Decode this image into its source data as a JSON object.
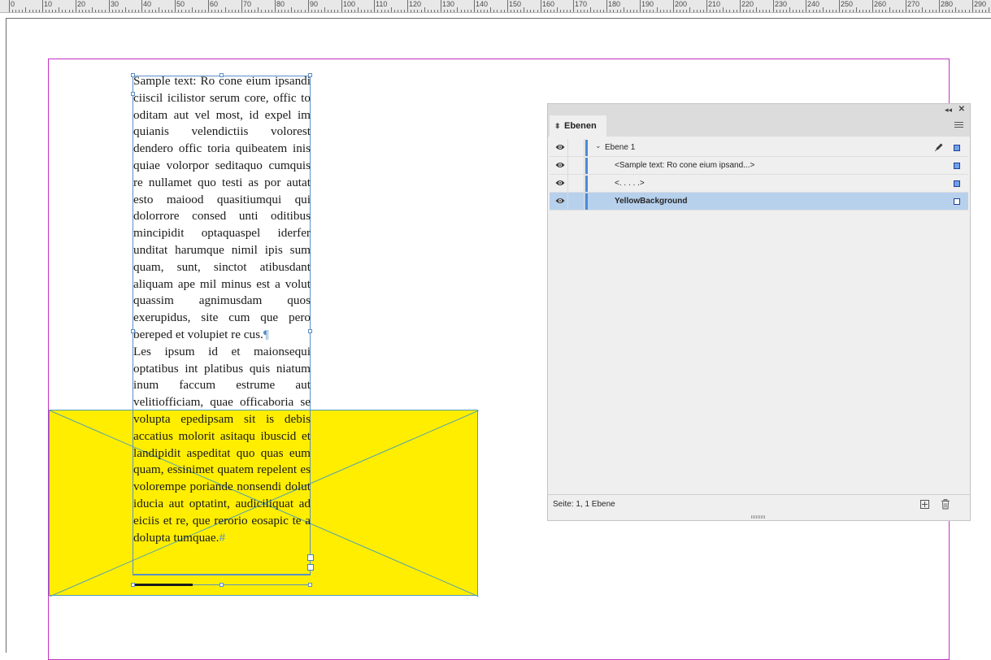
{
  "ruler": {
    "labels": [
      "0",
      "10",
      "20",
      "30",
      "40",
      "50",
      "60",
      "70",
      "80",
      "90",
      "100",
      "110",
      "120",
      "130",
      "140",
      "150",
      "160",
      "170",
      "180",
      "190",
      "200",
      "210",
      "220",
      "230",
      "240",
      "250",
      "260",
      "270",
      "280",
      "290"
    ]
  },
  "document": {
    "text_frame": {
      "paragraph1": "Sample text: Ro cone eium ipsandi ciiscil icilistor serum core, offic to oditam aut vel most, id expel im quianis velendictiis volorest dendero offic toria quibeatem inis quiae volorpor seditaquo cumquis re nullamet quo testi as por autat esto maiood quasitiumqui qui dolorrore consed unti oditibus mincipidit optaquaspel iderfer unditat harumque nimil ipis sum quam, sunt, sinctot atibusdant aliquam ape mil minus est a volut quassim agnimusdam quos exerupidus, site cum que pero bereped et volupiet re cus.",
      "paragraph2": "Les ipsum id et maionsequi optatibus int platibus quis niatum inum faccum estrume aut velitiofficiam, quae officaboria se volupta epedipsam sit is debis accatius molorit asitaqu ibuscid et landipidit aspeditat quo quas eum quam, essinimet quatem repelent es volorempe poriande nonsendi dolut iducia aut optatint, audiciliquat ad eiciis et re, que rerorio eosapic te a dolupta tumquae.",
      "pilcrow": "¶",
      "end_mark": "#"
    },
    "colors": {
      "yellow": "#ffee00",
      "frame_blue": "#5b8fc7",
      "margin_magenta": "#c233c2"
    }
  },
  "layers_panel": {
    "tab_label": "Ebenen",
    "tab_arrows": "⬍",
    "collapse_glyph": "◂◂",
    "close_glyph": "✕",
    "rows": [
      {
        "name": "Ebene 1",
        "bold": false,
        "indent": 1,
        "expanded": true,
        "has_pen": true,
        "square": "filled",
        "selected": false
      },
      {
        "name": "<Sample text: Ro cone eium ipsand...>",
        "bold": false,
        "indent": 2,
        "has_pen": false,
        "square": "filled",
        "selected": false
      },
      {
        "name": "<. . . . .>",
        "bold": false,
        "indent": 2,
        "has_pen": false,
        "square": "filled",
        "selected": false
      },
      {
        "name": "YellowBackground",
        "bold": true,
        "indent": 2,
        "has_pen": false,
        "square": "empty",
        "selected": true
      }
    ],
    "footer_text": "Seite: 1, 1 Ebene",
    "icons": {
      "visibility": "eye-icon",
      "expand": "chevron-down-icon",
      "edit": "pen-icon",
      "new_layer": "new-layer-icon",
      "delete": "trash-icon",
      "menu": "panel-menu-icon"
    }
  }
}
